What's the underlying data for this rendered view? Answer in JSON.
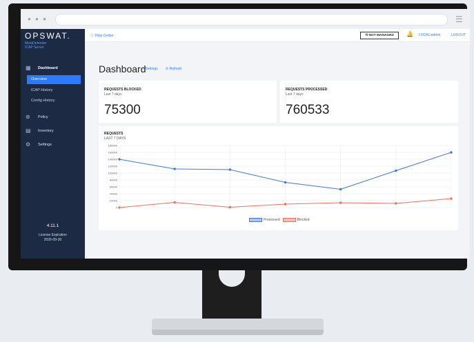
{
  "sidebar": {
    "logo": "OPSWAT.",
    "product_line1": "MetaDefender",
    "product_line2": "ICAP Server",
    "items": [
      {
        "label": "Dashboard",
        "icon": "dashboard-icon"
      },
      {
        "label": "Policy",
        "icon": "policy-icon"
      },
      {
        "label": "Inventory",
        "icon": "inventory-icon"
      },
      {
        "label": "Settings",
        "icon": "settings-icon"
      }
    ],
    "subitems": [
      {
        "label": "Overview"
      },
      {
        "label": "ICAP History"
      },
      {
        "label": "Config History"
      }
    ],
    "version": "4.11.1",
    "license_label": "License Expiration",
    "license_date": "2026-09-30"
  },
  "topbar": {
    "help": "Help Center",
    "not_managed": "NOT MANAGED",
    "user": "LOCAL\\admin",
    "logout": "LOGOUT"
  },
  "page": {
    "title": "Dashboard",
    "settings": "Settings",
    "refresh": "Refresh"
  },
  "cards": {
    "blocked": {
      "title": "REQUESTS BLOCKED",
      "sub": "Last 7 days",
      "value": "75300"
    },
    "processed": {
      "title": "REQUESTS PROCESSED",
      "sub": "Last 7 days",
      "value": "760533"
    }
  },
  "chart_data": {
    "type": "line",
    "title": "REQUESTS",
    "subtitle": "LAST 7 DAYS",
    "ylim": [
      0,
      180000
    ],
    "yticks": [
      0,
      20000,
      40000,
      60000,
      80000,
      100000,
      120000,
      140000,
      160000,
      180000
    ],
    "grid": true,
    "legend": "bottom",
    "series": [
      {
        "name": "Processed",
        "color": "#3b78e7",
        "values": [
          140000,
          112000,
          110000,
          73000,
          53000,
          107000,
          160000
        ]
      },
      {
        "name": "Blocked",
        "color": "#e8735a",
        "values": [
          0,
          15000,
          1000,
          10000,
          14000,
          12000,
          26000
        ]
      }
    ]
  },
  "colors": {
    "accent": "#2a7bff",
    "sidebar": "#1c2a44",
    "bell": "#e05a3a"
  }
}
